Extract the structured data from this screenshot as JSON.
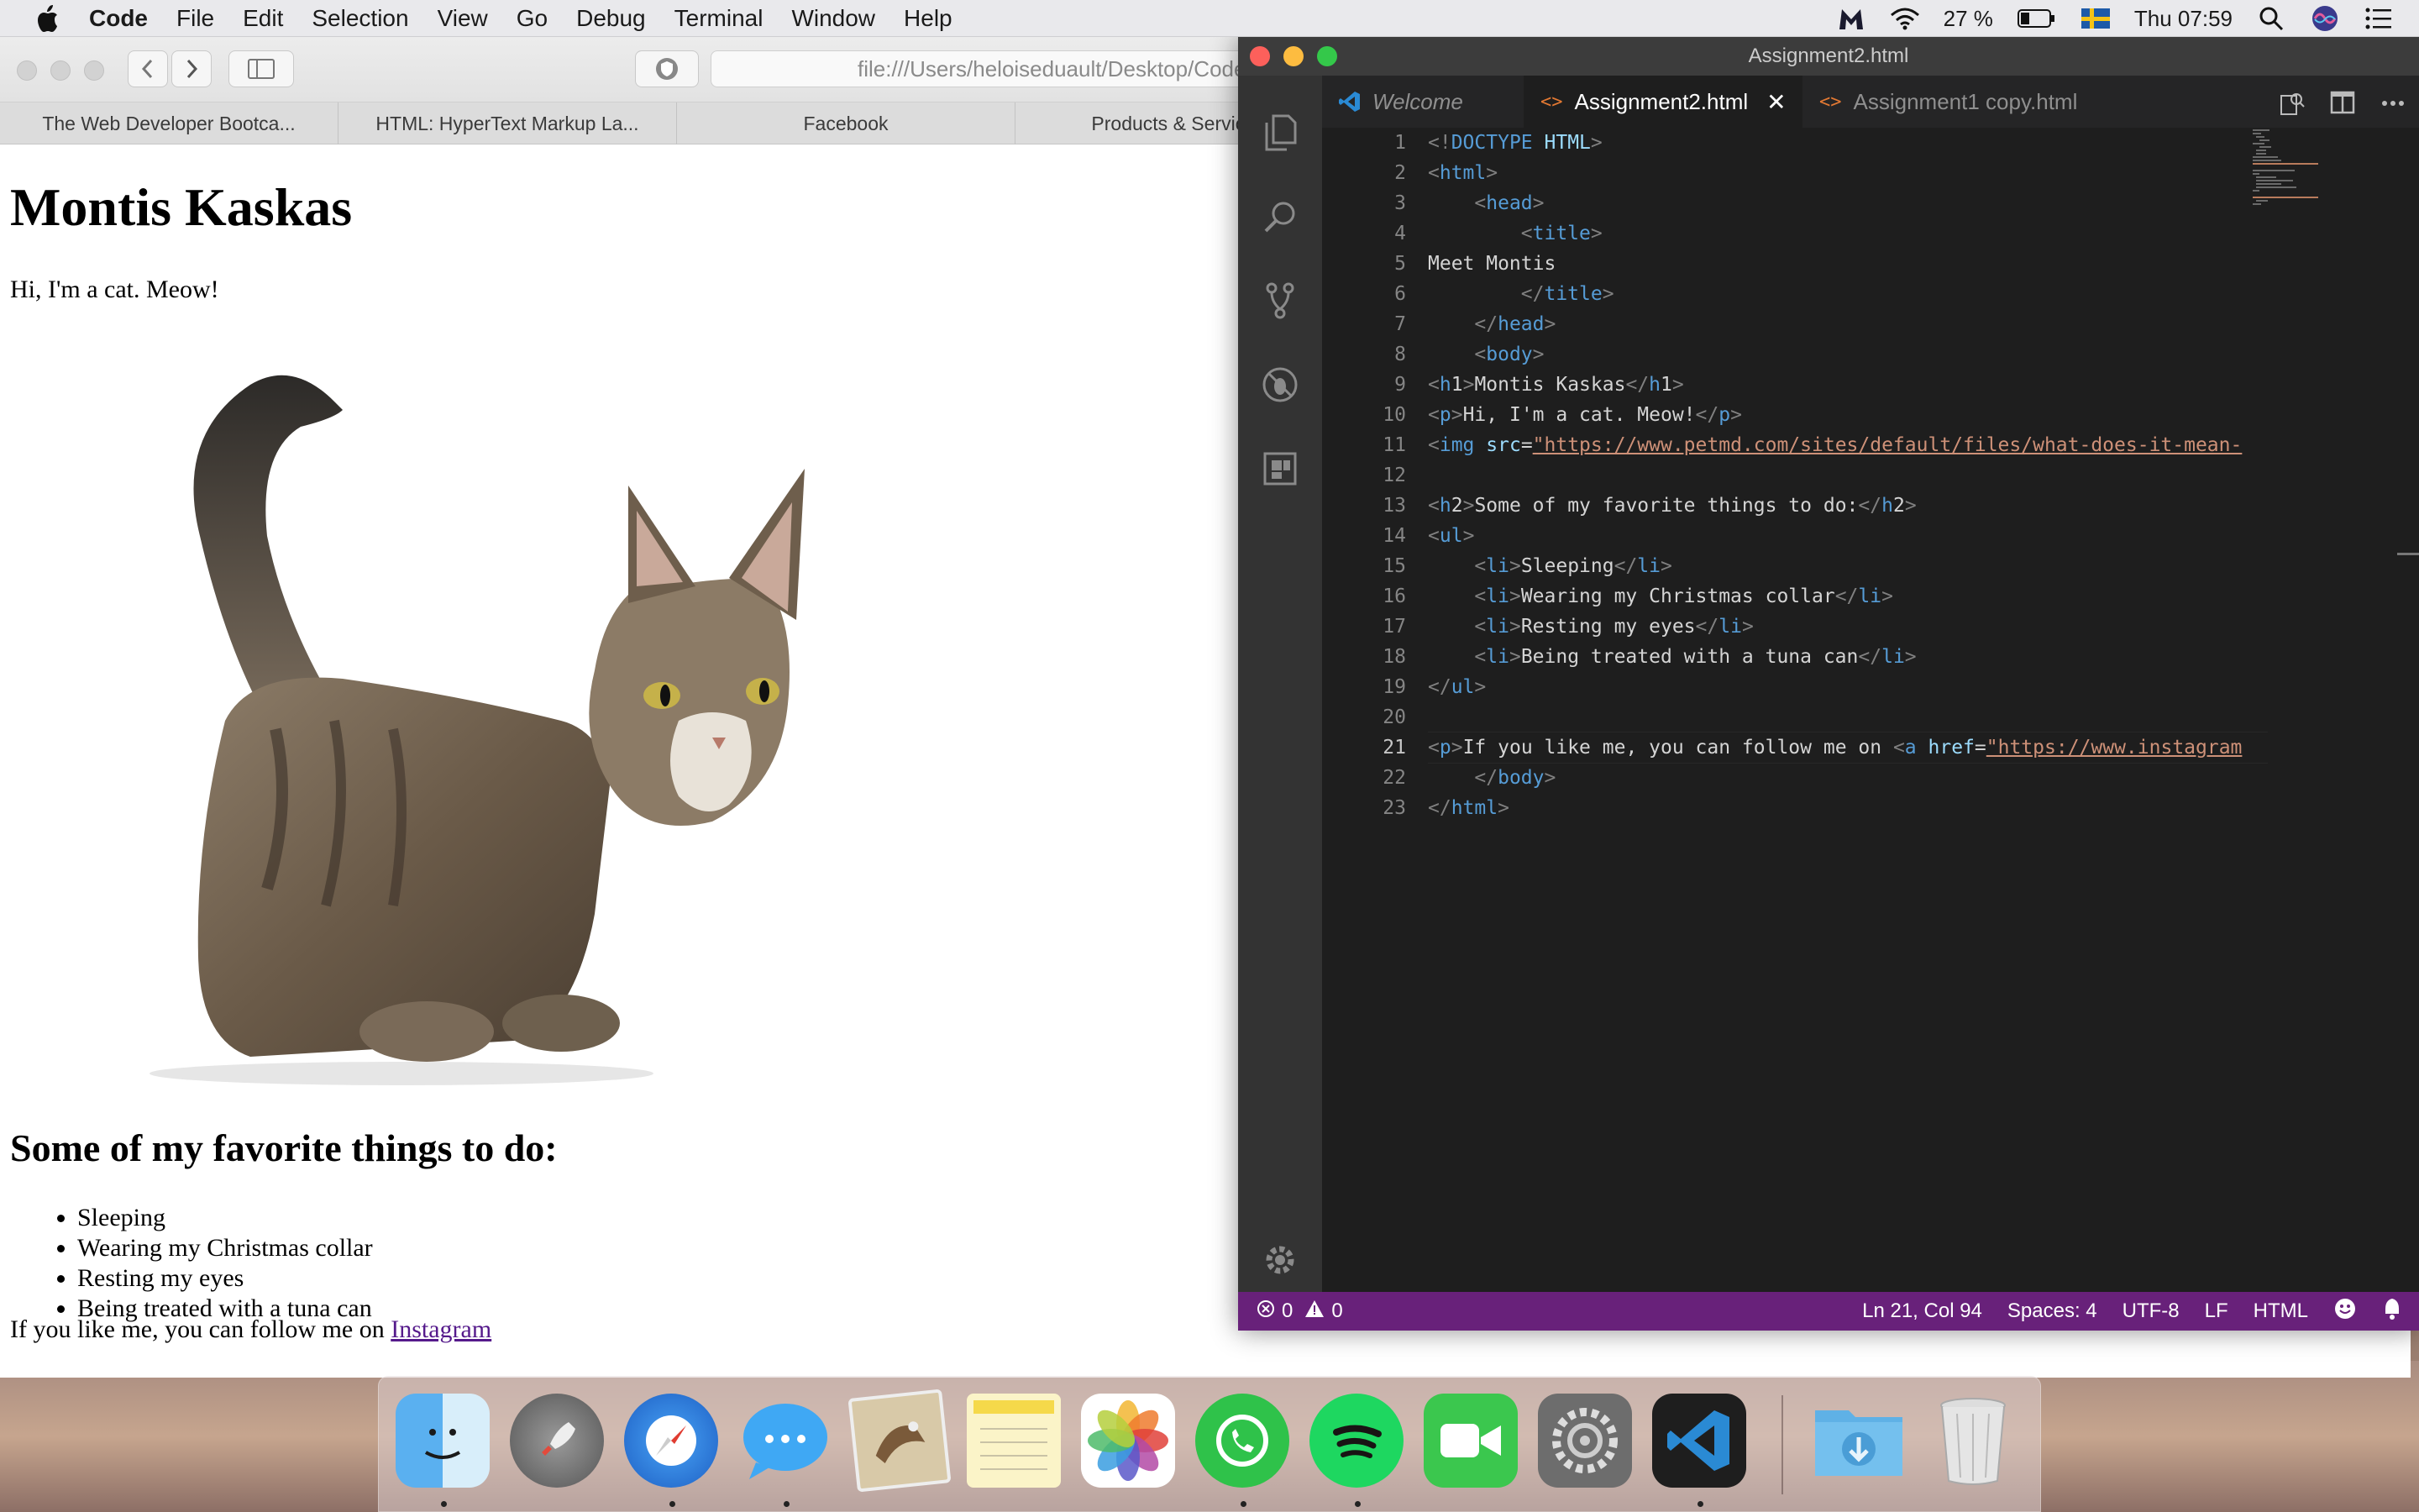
{
  "menubar": {
    "app_name": "Code",
    "items": [
      "File",
      "Edit",
      "Selection",
      "View",
      "Go",
      "Debug",
      "Terminal",
      "Window",
      "Help"
    ],
    "battery": "27 %",
    "clock": "Thu 07:59"
  },
  "safari": {
    "url": "file:///Users/heloiseduault/Desktop/Code",
    "tabs": [
      "The Web Developer Bootca...",
      "HTML: HyperText Markup La...",
      "Facebook",
      "Products & Services -"
    ],
    "page": {
      "h1": "Montis Kaskas",
      "intro": "Hi, I'm a cat. Meow!",
      "h2": "Some of my favorite things to do:",
      "list": [
        "Sleeping",
        "Wearing my Christmas collar",
        "Resting my eyes",
        "Being treated with a tuna can"
      ],
      "follow_text": "If you like me, you can follow me on ",
      "link_text": "Instagram"
    }
  },
  "vscode": {
    "title": "Assignment2.html",
    "tabs": [
      {
        "label": "Welcome",
        "active": false
      },
      {
        "label": "Assignment2.html",
        "active": true
      },
      {
        "label": "Assignment1 copy.html",
        "active": false
      }
    ],
    "current_line": 21,
    "code_lines": [
      "<!DOCTYPE HTML>",
      "<html>",
      "    <head>",
      "        <title>",
      "Meet Montis",
      "        </title>",
      "    </head>",
      "    <body>",
      "<h1>Montis Kaskas</h1>",
      "<p>Hi, I'm a cat. Meow!</p>",
      "<img src=\"https://www.petmd.com/sites/default/files/what-does-it-mean-",
      "",
      "<h2>Some of my favorite things to do:</h2>",
      "<ul>",
      "    <li>Sleeping</li>",
      "    <li>Wearing my Christmas collar</li>",
      "    <li>Resting my eyes</li>",
      "    <li>Being treated with a tuna can</li>",
      "</ul>",
      "",
      "<p>If you like me, you can follow me on <a href=\"https://www.instagram",
      "    </body>",
      "</html>"
    ],
    "status": {
      "errors": "0",
      "warnings": "0",
      "position": "Ln 21, Col 94",
      "spaces": "Spaces: 4",
      "encoding": "UTF-8",
      "eol": "LF",
      "language": "HTML"
    }
  },
  "dock": {
    "apps": [
      "finder-icon",
      "launchpad-icon",
      "safari-icon",
      "messages-icon",
      "mail-icon",
      "notes-icon",
      "photos-icon",
      "whatsapp-icon",
      "spotify-icon",
      "facetime-icon",
      "system-preferences-icon",
      "vscode-icon",
      "downloads-icon",
      "trash-icon"
    ]
  },
  "colors": {
    "statusbar": "#68217a",
    "vs_bg": "#1e1e1e",
    "tag": "#569cd6",
    "attr": "#9cdcfe",
    "string": "#ce9178"
  }
}
